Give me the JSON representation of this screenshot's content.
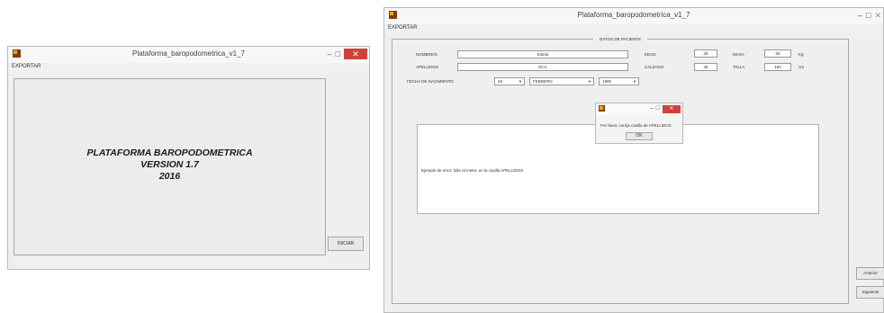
{
  "left_window": {
    "title": "Plataforma_baropodometrica_v1_7",
    "menu": "EXPORTAR",
    "splash": [
      "PLATAFORMA BAROPODOMETRICA",
      "VERSION 1.7",
      "2016"
    ],
    "start_button": "INICIAR",
    "controls": {
      "minimize": "–",
      "maximize": "□",
      "close": "✕"
    }
  },
  "right_window": {
    "title": "Plataforma_baropodometrica_v1_7",
    "menu": "EXPORTAR",
    "controls": {
      "minimize": "–",
      "maximize": "□",
      "close": "✕"
    },
    "panel_title": "DATOS DE PACIENTE",
    "labels": {
      "nombre": "NOMBRE/S",
      "apellidos": "APELLIDOS",
      "fecha": "FECHA DE NACIMIENTO",
      "edad": "EDAD",
      "calzado": "CALZADO",
      "masa": "MASA",
      "talla": "TALLA",
      "masa_unit": "Kg",
      "talla_unit": "cm"
    },
    "values": {
      "nombre": "Estela",
      "apellidos": "ECA",
      "edad": "25",
      "calzado": "35",
      "masa": "55",
      "talla": "160"
    },
    "date": {
      "day": "29",
      "month": "FEBRERO",
      "year": "1990"
    },
    "message_area": "Ejemplo de error: fallo al meter, en la casilla APELLIDOS",
    "buttons": {
      "prev": "Anterior",
      "next": "Siguiente"
    }
  },
  "dialog": {
    "message": "Por favor, corrija casilla de APELLIDOS",
    "ok": "OK",
    "controls": {
      "minimize": "–",
      "maximize": "□",
      "close": "✕"
    }
  }
}
